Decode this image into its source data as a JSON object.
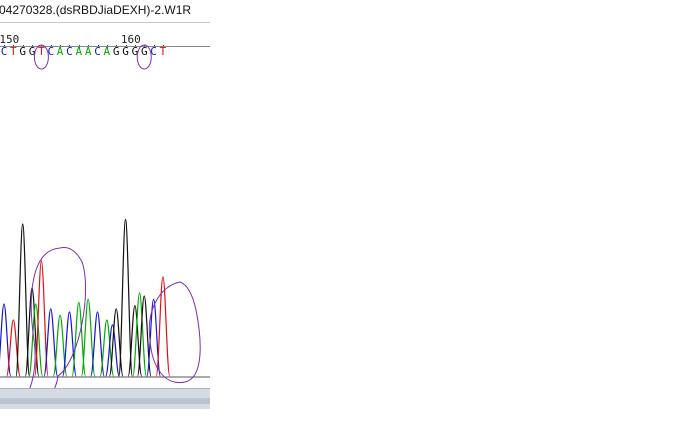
{
  "window": {
    "title": "04270328.(dsRBDJiaDEXH)-2.W1R"
  },
  "ruler": {
    "positions": [
      {
        "label": "150",
        "index": 1
      },
      {
        "label": "160",
        "index": 14
      }
    ]
  },
  "sequence": {
    "bases": [
      "C",
      "T",
      "G",
      "G",
      "T",
      "C",
      "A",
      "C",
      "A",
      "A",
      "C",
      "A",
      "G",
      "G",
      "G",
      "G",
      "C",
      "T"
    ],
    "circled_indices": [
      4,
      15
    ]
  },
  "colors": {
    "A": "#00aa00",
    "C": "#1414d2",
    "G": "#111111",
    "T": "#dd1111",
    "annotation": "#7a2fb0"
  },
  "trace": {
    "peaks": [
      {
        "base": "C",
        "i": 0,
        "h": 0.45
      },
      {
        "base": "T",
        "i": 1,
        "h": 0.35
      },
      {
        "base": "G",
        "i": 2,
        "h": 0.95
      },
      {
        "base": "G",
        "i": 3,
        "h": 0.55
      },
      {
        "base": "A",
        "i": 3.4,
        "h": 0.45
      },
      {
        "base": "T",
        "i": 4,
        "h": 0.72
      },
      {
        "base": "C",
        "i": 5,
        "h": 0.42
      },
      {
        "base": "A",
        "i": 6,
        "h": 0.38
      },
      {
        "base": "C",
        "i": 7,
        "h": 0.4
      },
      {
        "base": "A",
        "i": 8,
        "h": 0.46
      },
      {
        "base": "A",
        "i": 9,
        "h": 0.48
      },
      {
        "base": "C",
        "i": 10,
        "h": 0.4
      },
      {
        "base": "A",
        "i": 11,
        "h": 0.35
      },
      {
        "base": "C",
        "i": 11.6,
        "h": 0.32
      },
      {
        "base": "G",
        "i": 12,
        "h": 0.42
      },
      {
        "base": "G",
        "i": 13,
        "h": 0.98
      },
      {
        "base": "G",
        "i": 14,
        "h": 0.44
      },
      {
        "base": "A",
        "i": 14.5,
        "h": 0.52
      },
      {
        "base": "G",
        "i": 15,
        "h": 0.5
      },
      {
        "base": "C",
        "i": 16,
        "h": 0.48
      },
      {
        "base": "T",
        "i": 17,
        "h": 0.62
      }
    ]
  }
}
